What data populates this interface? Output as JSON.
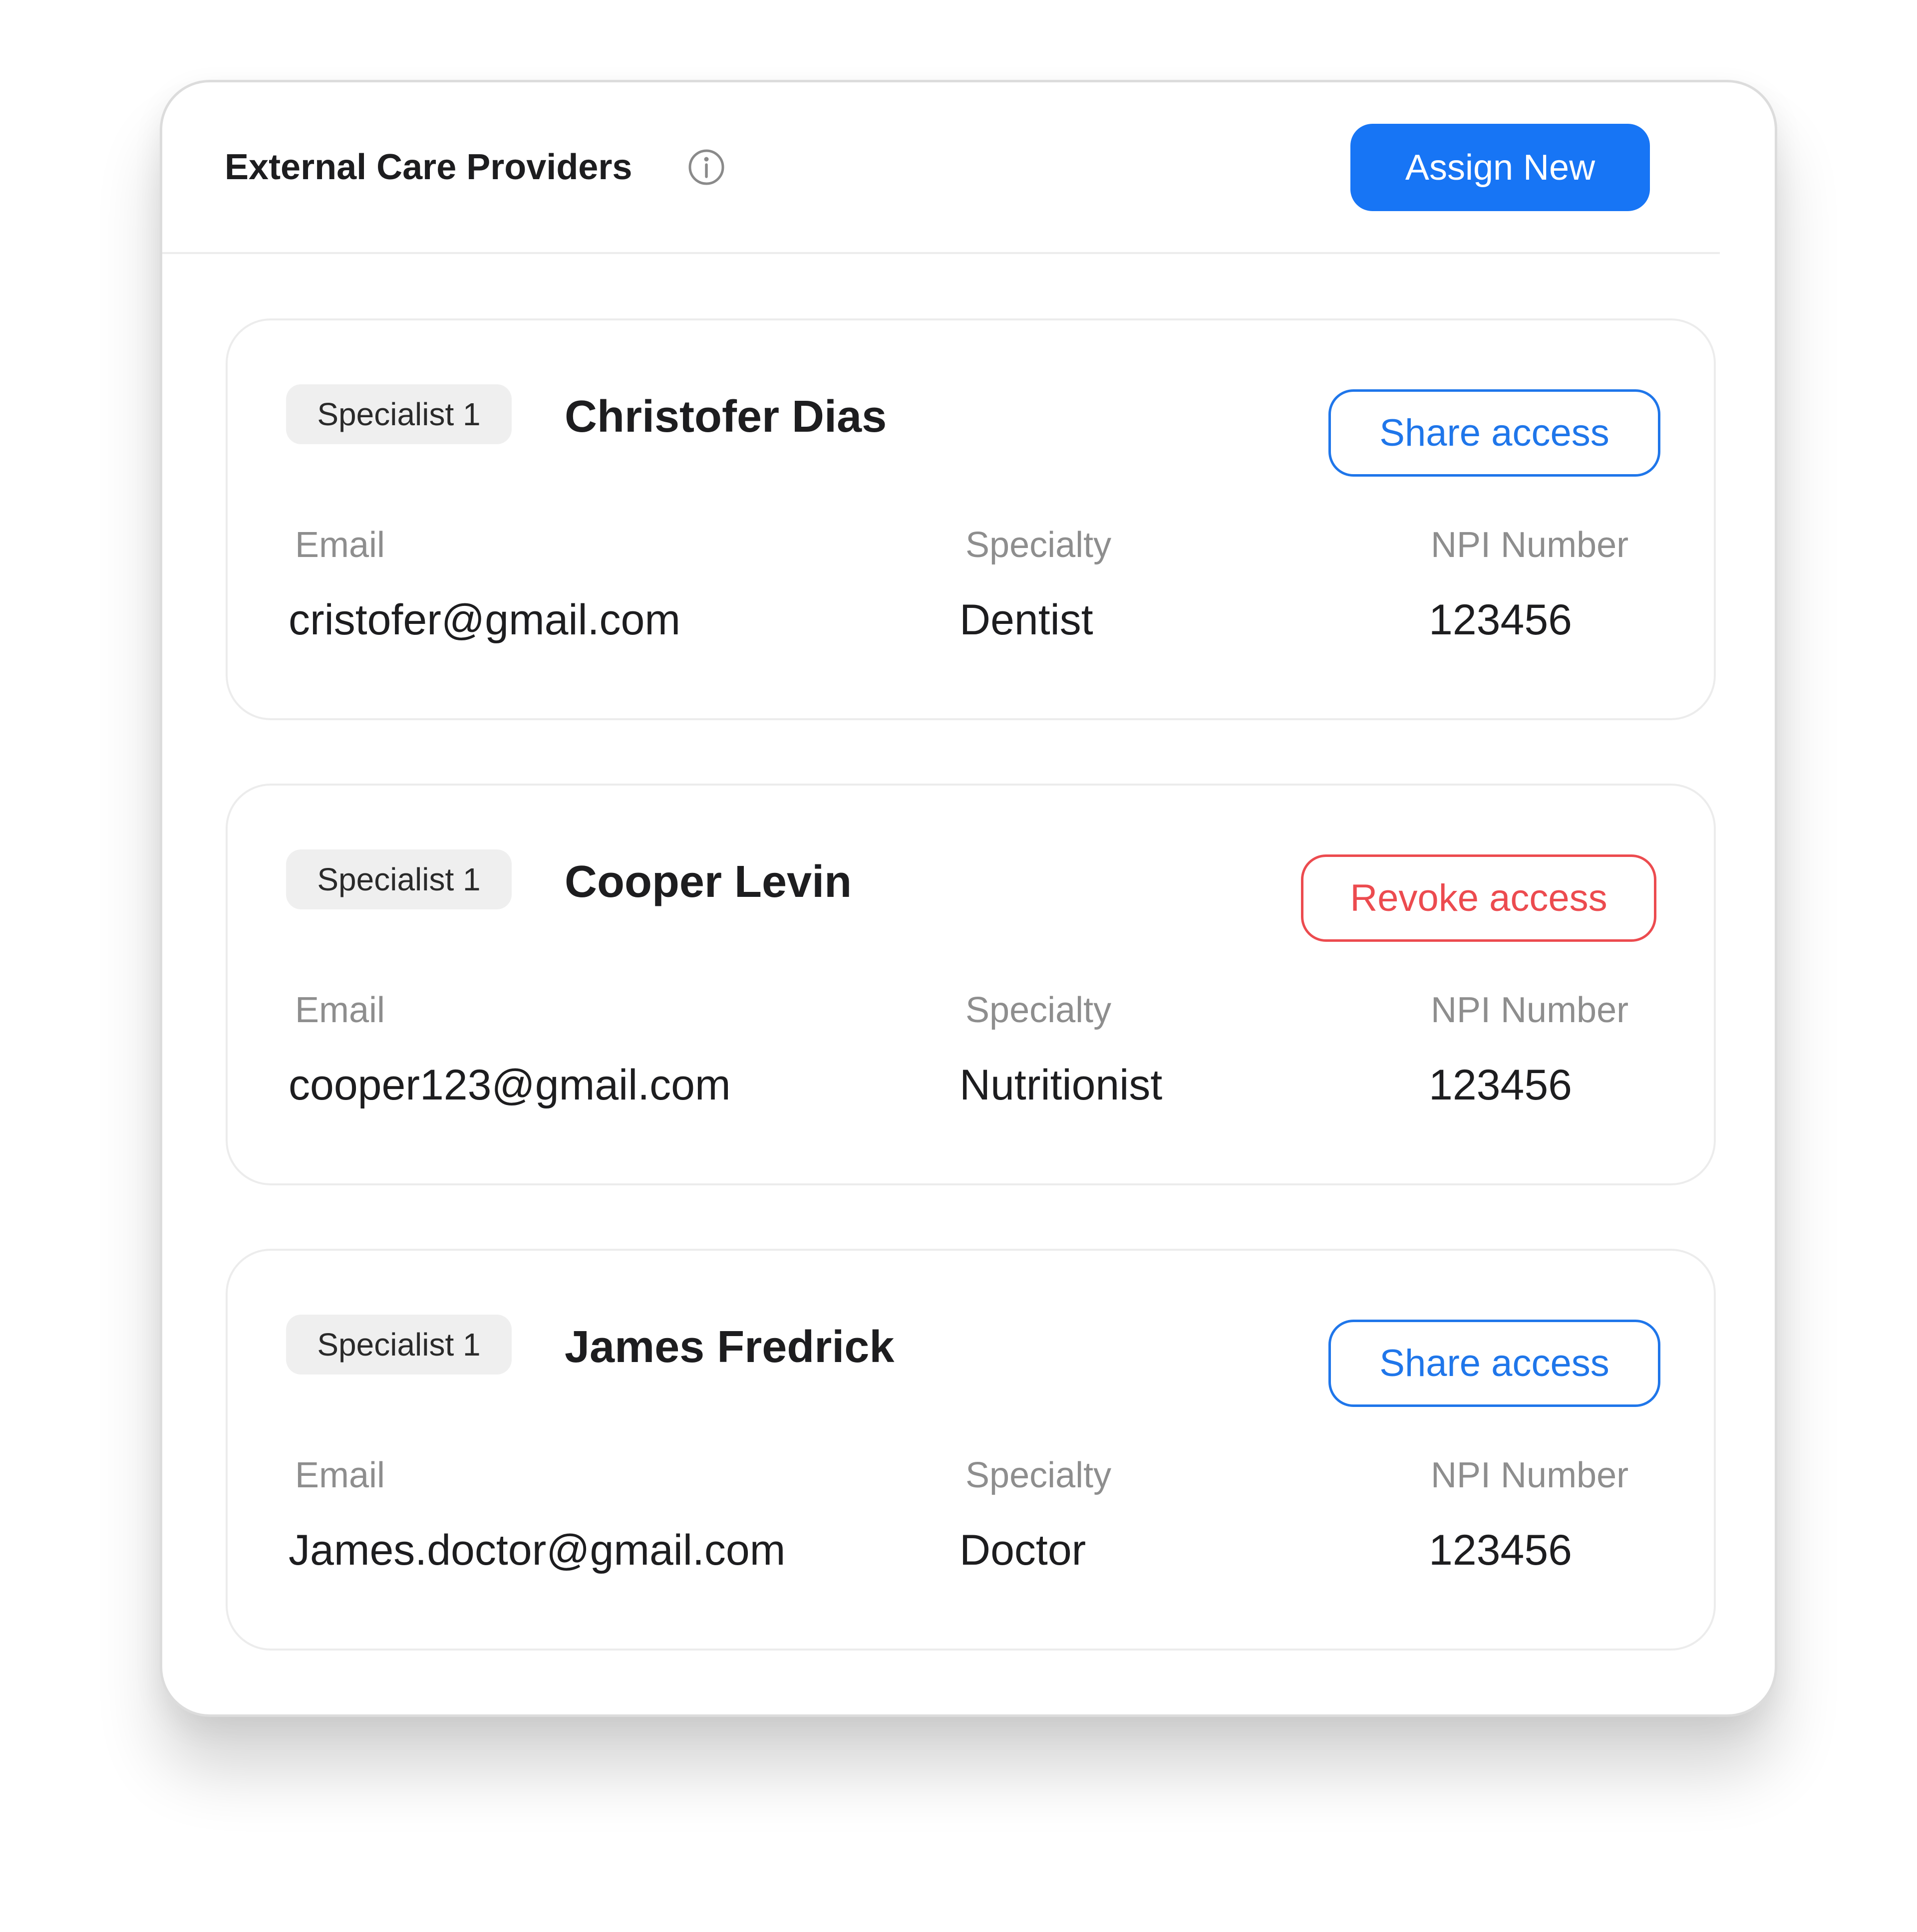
{
  "header": {
    "title": "External Care Providers",
    "assign_label": "Assign New"
  },
  "colors": {
    "primary_blue": "#1775f5",
    "share_blue": "#1f76ea",
    "revoke_red": "#ec4b4f",
    "badge_bg": "#efefef",
    "label_gray": "#8e8e8e"
  },
  "fields": {
    "email_label": "Email",
    "specialty_label": "Specialty",
    "npi_label": "NPI Number"
  },
  "providers": [
    {
      "badge": "Specialist 1",
      "name": "Christofer Dias",
      "action_label": "Share access",
      "action_type": "share",
      "email": "cristofer@gmail.com",
      "specialty": "Dentist",
      "npi": "123456"
    },
    {
      "badge": "Specialist 1",
      "name": "Cooper Levin",
      "action_label": "Revoke access",
      "action_type": "revoke",
      "email": "cooper123@gmail.com",
      "specialty": "Nutritionist",
      "npi": "123456"
    },
    {
      "badge": "Specialist 1",
      "name": "James Fredrick",
      "action_label": "Share access",
      "action_type": "share",
      "email": "James.doctor@gmail.com",
      "specialty": "Doctor",
      "npi": "123456"
    }
  ]
}
